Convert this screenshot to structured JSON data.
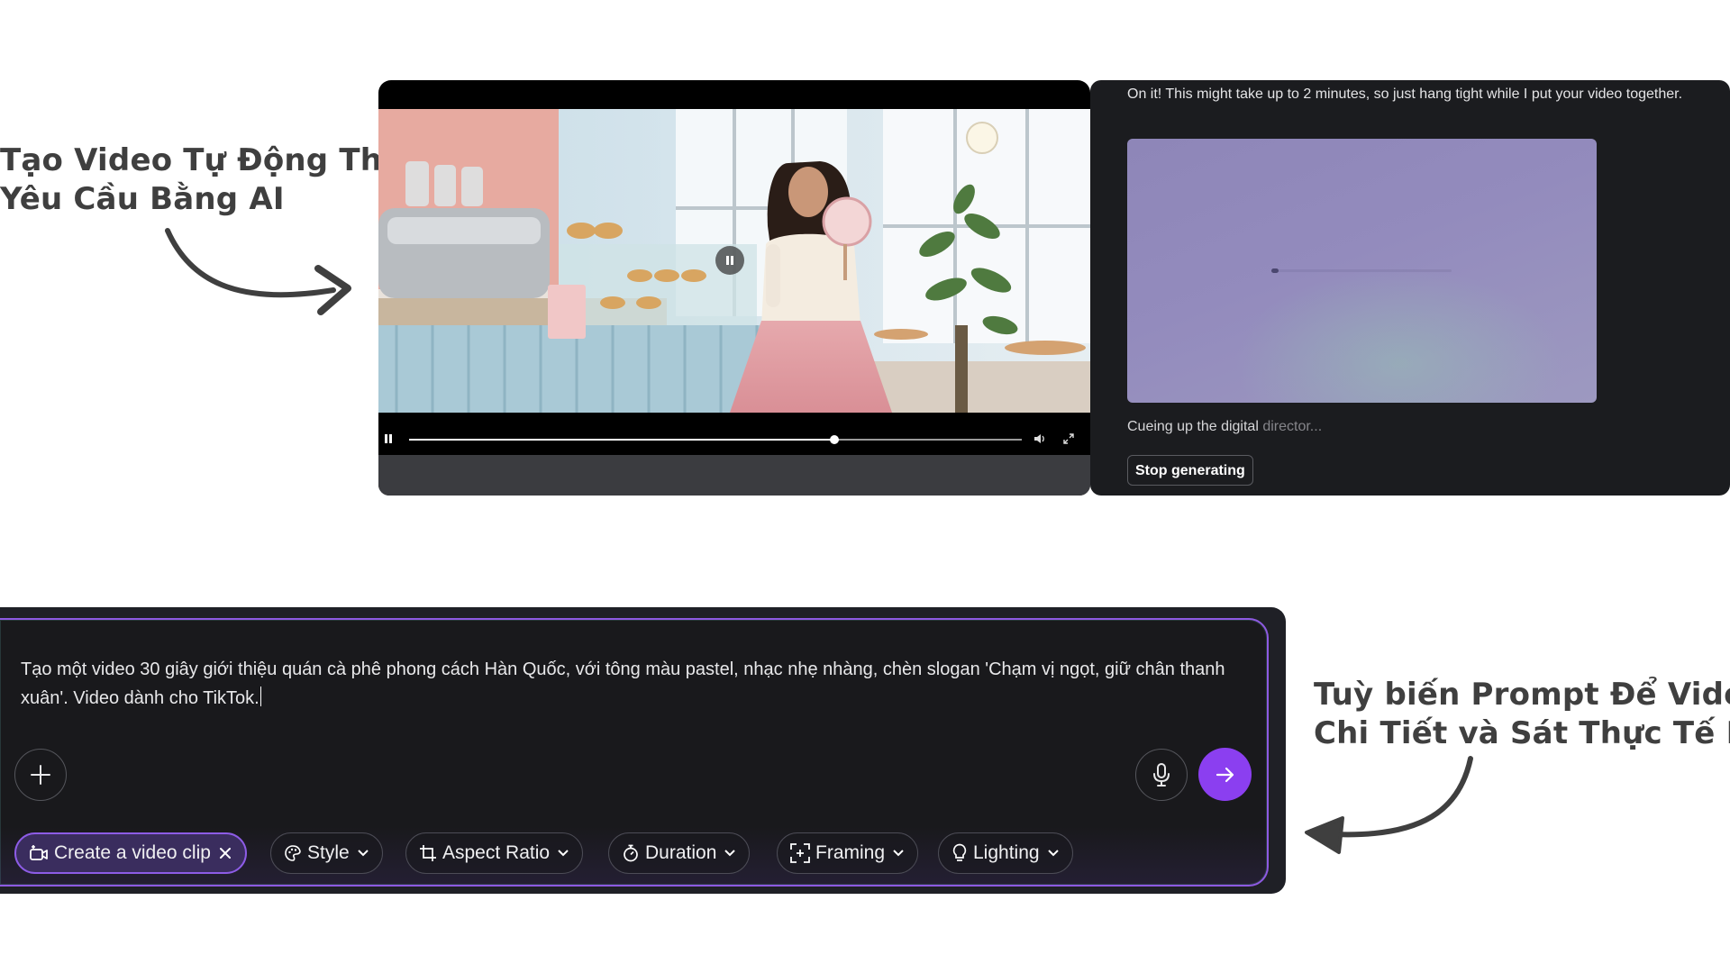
{
  "annotations": {
    "left": {
      "line1": "Tạo Video Tự Động Theo",
      "line2": "Yêu Cầu Bằng AI"
    },
    "right": {
      "line1": "Tuỳ biến Prompt Để Video",
      "line2": "Chi Tiết và Sát Thực Tế Hơn"
    }
  },
  "video_player": {
    "progress_fraction": 0.694,
    "icons": {
      "pause": "pause-icon",
      "volume": "volume-icon",
      "fullscreen": "fullscreen-icon",
      "overlay": "pause-overlay-icon"
    }
  },
  "generation_panel": {
    "status_message": "On it! This might take up to 2 minutes, so just hang tight while I put your video together.",
    "caption_bright": "Cueing up the digital ",
    "caption_dim": "director...",
    "loader_fraction": 0.03,
    "stop_button_label": "Stop generating"
  },
  "prompt": {
    "text": "Tạo một video 30 giây giới thiệu quán cà phê phong cách Hàn Quốc, với tông màu pastel, nhạc nhẹ nhàng, chèn slogan 'Chạm vị ngọt, giữ chân thanh xuân'. Video dành cho TikTok.",
    "accent_color": "#8b3ff0"
  },
  "chips": {
    "create": "Create a video clip",
    "style": "Style",
    "aspect": "Aspect Ratio",
    "duration": "Duration",
    "framing": "Framing",
    "lighting": "Lighting"
  }
}
